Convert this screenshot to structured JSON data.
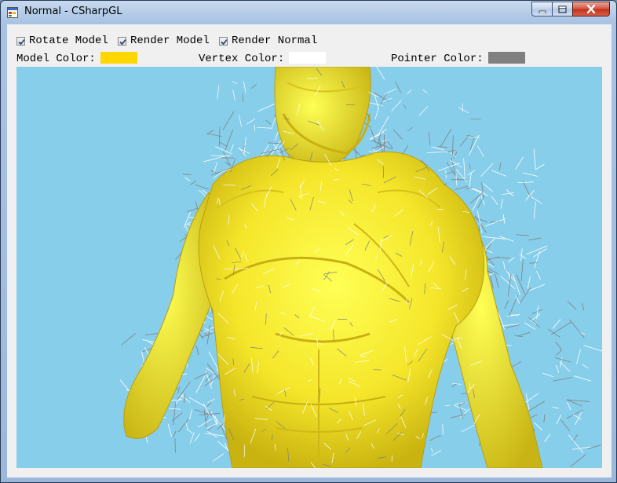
{
  "window": {
    "title": "Normal - CSharpGL"
  },
  "options": {
    "rotate_model": {
      "label": "Rotate Model",
      "checked": true
    },
    "render_model": {
      "label": "Render Model",
      "checked": true
    },
    "render_normal": {
      "label": "Render Normal",
      "checked": true
    }
  },
  "colors": {
    "model_color_label": "Model Color:",
    "model_color": "#ffd700",
    "vertex_color_label": "Vertex Color:",
    "vertex_color": "#ffffff",
    "pointer_color_label": "Pointer Color:",
    "pointer_color": "#808080"
  },
  "viewport": {
    "background": "#87ceeb",
    "model_fill": "#ffee33"
  }
}
